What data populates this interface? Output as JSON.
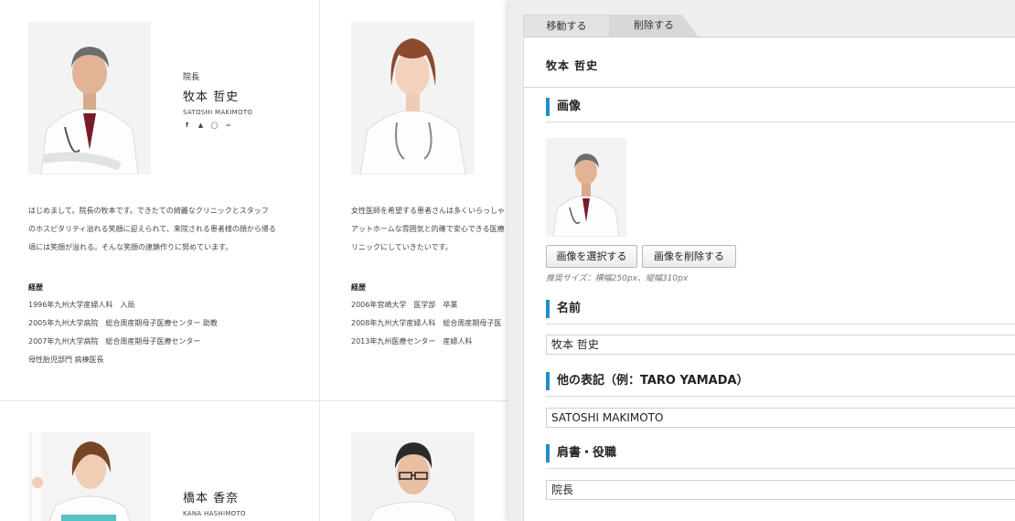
{
  "site": {
    "doctors": [
      {
        "role": "院長",
        "name": "牧本 哲史",
        "name_roman": "SATOSHI MAKIMOTO",
        "social_icons": [
          "facebook-icon",
          "twitter-icon",
          "instagram-icon",
          "rss-icon"
        ],
        "intro": [
          "はじめまして。院長の牧本です。できたての綺麗なクリニックとスタッフ",
          "のホスピタリティ溢れる笑顔に迎えられて、来院される患者様の顔から帰る",
          "頃には笑顔が溢れる。そんな笑顔の連鎖作りに努めています。"
        ],
        "career_heading": "経歴",
        "career": [
          "1996年九州大学産婦人科　入局",
          "2005年九州大学病院　総合周産期母子医療センター 助教",
          "2007年九州大学病院　総合周産期母子医療センター",
          "母性胎児部門 病棟医長"
        ]
      },
      {
        "intro": [
          "女性医師を希望する患者さんは多くいらっしゃ",
          "アットホームな雰囲気と的確で安心できる医療",
          "リニックにしていきたいです。"
        ],
        "career_heading": "経歴",
        "career": [
          "2006年宮崎大学　医学部　卒業",
          "2008年九州大学産婦人科　総合周産期母子医",
          "2013年九州医療センター　産婦人科"
        ]
      },
      {
        "name": "橋本 香奈",
        "name_roman": "KANA HASHIMOTO"
      }
    ]
  },
  "panel": {
    "tabs": {
      "move": "移動する",
      "delete": "削除する"
    },
    "title": "牧本 哲史",
    "image_section": {
      "heading": "画像",
      "select_button": "画像を選択する",
      "remove_button": "画像を削除する",
      "hint": "推奨サイズ：横幅250px、縦幅310px"
    },
    "name_section": {
      "heading": "名前",
      "value": "牧本 哲史"
    },
    "alt_name_section": {
      "heading": "他の表記（例：TARO YAMADA）",
      "value": "SATOSHI MAKIMOTO"
    },
    "position_section": {
      "heading": "肩書・役職",
      "value": "院長"
    }
  }
}
